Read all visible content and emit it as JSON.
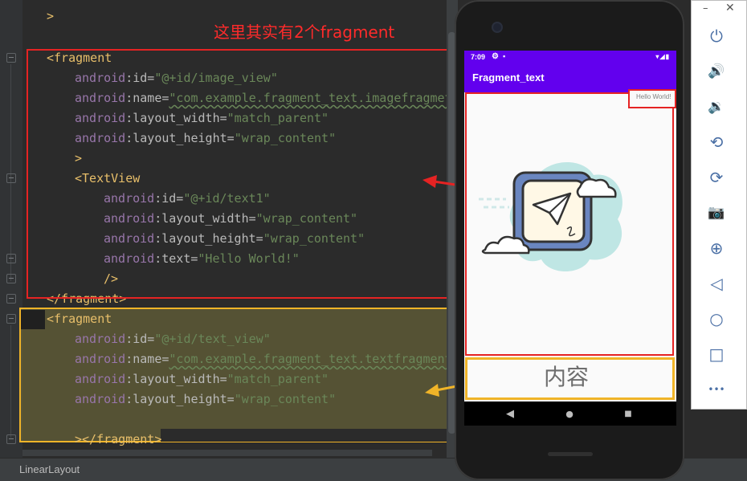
{
  "annotation": {
    "note": "这里其实有2个fragment",
    "note_color": "#ff2b2b"
  },
  "code": {
    "lines": [
      {
        "id": "l0",
        "text": ">"
      },
      {
        "id": "l1",
        "tag_open": "<fragment"
      },
      {
        "id": "l2",
        "ns": "android",
        "attr": ":id=",
        "value": "\"@+id/image_view\""
      },
      {
        "id": "l3",
        "ns": "android",
        "attr": ":name=",
        "value": "\"com.example.fragment_text.imagefragmet\""
      },
      {
        "id": "l4",
        "ns": "android",
        "attr": ":layout_width=",
        "value": "\"match_parent\""
      },
      {
        "id": "l5",
        "ns": "android",
        "attr": ":layout_height=",
        "value": "\"wrap_content\""
      },
      {
        "id": "l6",
        "text": ">"
      },
      {
        "id": "l7",
        "tag_open": "<TextView"
      },
      {
        "id": "l8",
        "ns": "android",
        "attr": ":id=",
        "value": "\"@+id/text1\""
      },
      {
        "id": "l9",
        "ns": "android",
        "attr": ":layout_width=",
        "value": "\"wrap_content\""
      },
      {
        "id": "l10",
        "ns": "android",
        "attr": ":layout_height=",
        "value": "\"wrap_content\""
      },
      {
        "id": "l11",
        "ns": "android",
        "attr": ":text=",
        "value": "\"Hello World!\""
      },
      {
        "id": "l12",
        "text": "/>"
      },
      {
        "id": "l13",
        "text": "</fragment>"
      },
      {
        "id": "l14",
        "tag_open": "<fragment"
      },
      {
        "id": "l15",
        "ns": "android",
        "attr": ":id=",
        "value": "\"@+id/text_view\""
      },
      {
        "id": "l16",
        "ns": "android",
        "attr": ":name=",
        "value": "\"com.example.fragment_text.textfragment\""
      },
      {
        "id": "l17",
        "ns": "android",
        "attr": ":layout_width=",
        "value": "\"match_parent\""
      },
      {
        "id": "l18",
        "ns": "android",
        "attr": ":layout_height=",
        "value": "\"wrap_content\""
      },
      {
        "id": "l19",
        "text": "></fragment>"
      }
    ]
  },
  "statusbar": {
    "breadcrumb": "LinearLayout"
  },
  "device": {
    "status_time": "7:09",
    "status_gear": "⚙",
    "status_icons": "▪",
    "status_signal": "▾◢▮",
    "app_title": "Fragment_text",
    "hello_text": "Hello World!",
    "content_text": "内容",
    "nav": {
      "back": "◀",
      "home": "●",
      "recents": "■"
    },
    "colors": {
      "primary": "#6200ee",
      "fragment1_outline": "#e52323",
      "fragment2_outline": "#f0b428"
    }
  },
  "emulator_toolbar": {
    "minimize": "–",
    "close": "✕",
    "buttons": [
      {
        "name": "power-icon",
        "glyph": "⏻"
      },
      {
        "name": "volume-up-icon",
        "glyph": "🔊"
      },
      {
        "name": "volume-down-icon",
        "glyph": "🔉"
      },
      {
        "name": "rotate-left-icon",
        "glyph": "⟲"
      },
      {
        "name": "rotate-right-icon",
        "glyph": "⟳"
      },
      {
        "name": "camera-icon",
        "glyph": "📷"
      },
      {
        "name": "zoom-icon",
        "glyph": "⊕"
      },
      {
        "name": "back-icon",
        "glyph": "◁"
      },
      {
        "name": "home-icon",
        "glyph": "○"
      },
      {
        "name": "overview-icon",
        "glyph": "□"
      },
      {
        "name": "more-icon",
        "glyph": "•••"
      }
    ]
  }
}
